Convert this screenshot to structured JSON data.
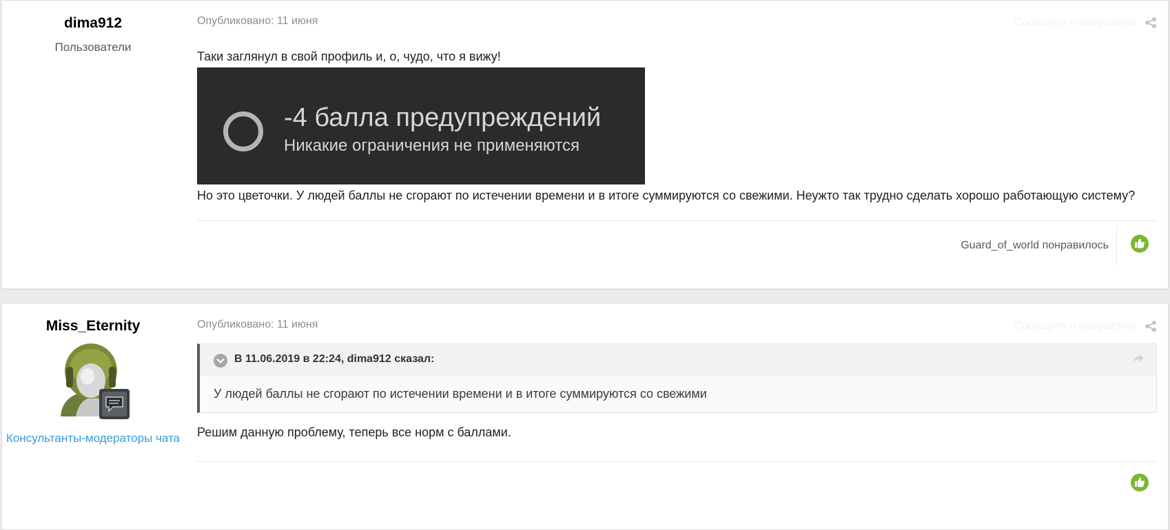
{
  "posts": [
    {
      "author": "dima912",
      "group": "Пользователи",
      "posted": "Опубликовано: 11 июня",
      "report_label": "Сообщить о нарушении",
      "text1": "Таки заглянул в свой профиль и, о, чудо, что я вижу!",
      "image": {
        "title": "-4 балла предупреждений",
        "subtitle": "Никакие ограничения не применяются"
      },
      "text2": "Но это цветочки. У людей баллы не сгорают по истечении времени и в итоге суммируются со свежими. Неужто так трудно сделать хорошо работающую систему?",
      "reaction_text": "Guard_of_world понравилось"
    },
    {
      "author": "Miss_Eternity",
      "group": "Консультанты-модераторы чата",
      "posted": "Опубликовано: 11 июня",
      "report_label": "Сообщить о нарушении",
      "quote": {
        "cite": "В 11.06.2019 в 22:24, dima912 сказал:",
        "text": "У людей баллы не сгорают по истечении времени и в итоге суммируются со свежими"
      },
      "text": "Решим данную проблему, теперь все норм с баллами."
    }
  ],
  "colors": {
    "like": "#7cb82f",
    "link": "#3a9ad9",
    "quote_border": "#555b60"
  }
}
